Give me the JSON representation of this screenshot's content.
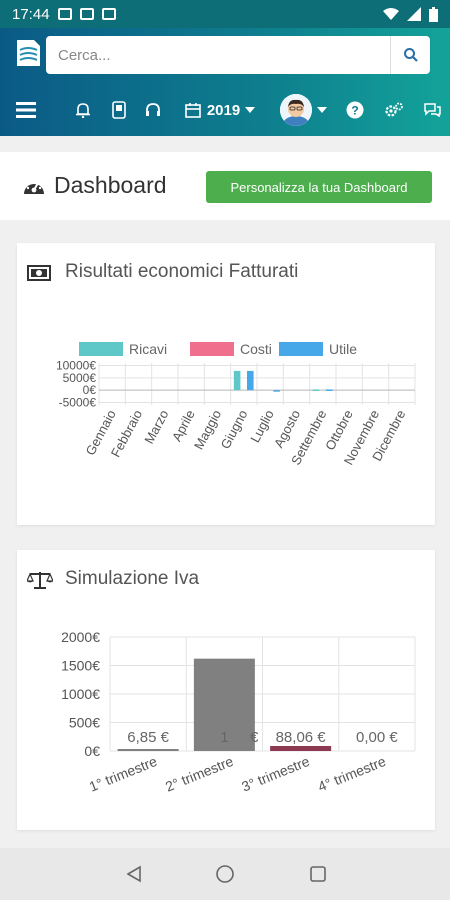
{
  "status_bar": {
    "time": "17:44"
  },
  "search": {
    "placeholder": "Cerca..."
  },
  "toolbar": {
    "year": "2019"
  },
  "dashboard": {
    "title": "Dashboard",
    "customize_button": "Personalizza la tua Dashboard"
  },
  "card1": {
    "title": "Risultati economici Fatturati"
  },
  "card2": {
    "title": "Simulazione Iva"
  },
  "colors": {
    "ricavi": "#5ec8c8",
    "costi": "#f06f8c",
    "utile": "#46a8e8",
    "iva_bar": "#808080",
    "button_green": "#4cae4c"
  },
  "chart_data": [
    {
      "type": "bar",
      "title": "Risultati economici Fatturati",
      "categories": [
        "Gennaio",
        "Febbraio",
        "Marzo",
        "Aprile",
        "Maggio",
        "Giugno",
        "Luglio",
        "Agosto",
        "Settembre",
        "Ottobre",
        "Novembre",
        "Dicembre"
      ],
      "series": [
        {
          "name": "Ricavi",
          "values": [
            0,
            0,
            0,
            0,
            0,
            7800,
            0,
            0,
            300,
            0,
            0,
            0
          ]
        },
        {
          "name": "Costi",
          "values": [
            0,
            0,
            0,
            0,
            0,
            0,
            0,
            0,
            0,
            0,
            0,
            0
          ]
        },
        {
          "name": "Utile",
          "values": [
            0,
            0,
            0,
            0,
            0,
            7800,
            -600,
            0,
            300,
            0,
            0,
            0
          ]
        }
      ],
      "yticks": [
        "10000€",
        "5000€",
        "0€",
        "-5000€"
      ],
      "ylim": [
        -6000,
        11000
      ],
      "legend_position": "top",
      "grid": true
    },
    {
      "type": "bar",
      "title": "Simulazione Iva",
      "categories": [
        "1° trimestre",
        "2° trimestre",
        "3° trimestre",
        "4° trimestre"
      ],
      "values": [
        6.85,
        1620,
        88.06,
        0
      ],
      "value_labels": [
        "6,85 €",
        "1",
        "88,06 €",
        "0,00 €"
      ],
      "label_suffix": "€",
      "yticks": [
        "2000€",
        "1500€",
        "1000€",
        "500€",
        "0€"
      ],
      "ylim": [
        0,
        2000
      ],
      "grid": true
    }
  ]
}
